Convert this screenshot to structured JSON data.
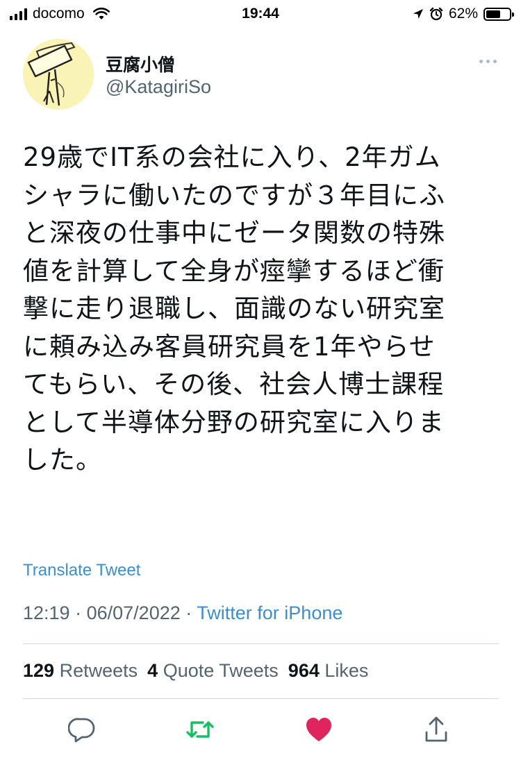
{
  "status_bar": {
    "carrier": "docomo",
    "time": "19:44",
    "battery": "62%",
    "battery_level": 0.62
  },
  "tweet": {
    "display_name": "豆腐小僧",
    "handle": "@KatagiriSo",
    "text": "29歳でIT系の会社に入り、2年ガム\nシャラに働いたのですが３年目にふ\nと深夜の仕事中にゼータ関数の特殊\n値を計算して全身が痙攣するほど衝\n撃に走り退職し、面識のない研究室\nに頼み込み客員研究員を1年やらせ\nてもらい、その後、社会人博士課程\nとして半導体分野の研究室に入りま\nした。",
    "translate_label": "Translate Tweet",
    "time": "12:19",
    "date": "06/07/2022",
    "separator": "·",
    "source": "Twitter for iPhone"
  },
  "stats": {
    "retweets_count": "129",
    "retweets_label": "Retweets",
    "quotes_count": "4",
    "quotes_label": "Quote Tweets",
    "likes_count": "964",
    "likes_label": "Likes"
  },
  "actions": {
    "reply_icon": "reply-icon",
    "retweet_icon": "retweet-icon",
    "like_icon": "heart-icon",
    "share_icon": "share-icon"
  },
  "colors": {
    "link": "#3a8fd0",
    "retweet_active": "#17bf63",
    "like_active": "#e0245e",
    "muted": "#536471"
  }
}
